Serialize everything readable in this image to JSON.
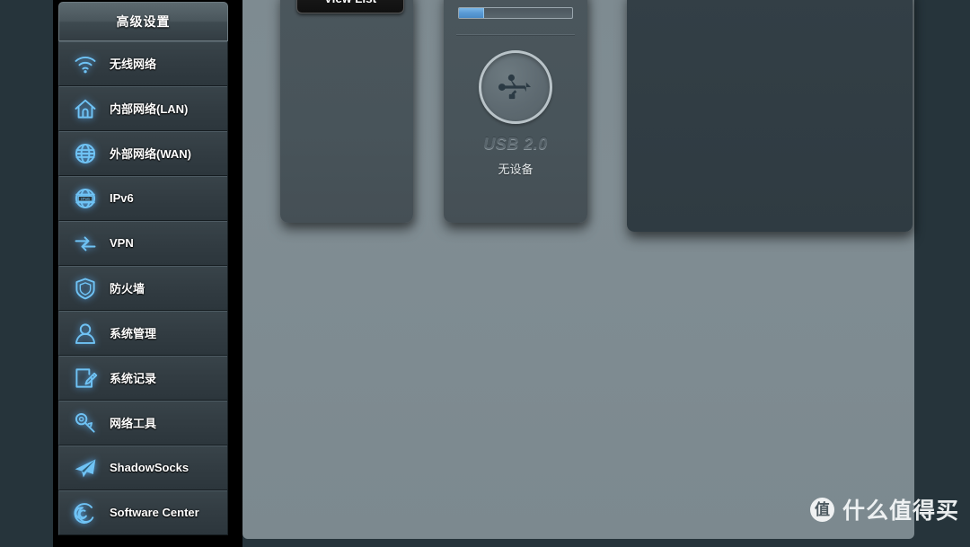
{
  "sidebar": {
    "header": "高级设置",
    "items": [
      {
        "label": "无线网络",
        "icon": "wifi-icon"
      },
      {
        "label": "内部网络(LAN)",
        "icon": "home-icon"
      },
      {
        "label": "外部网络(WAN)",
        "icon": "globe-icon"
      },
      {
        "label": "IPv6",
        "icon": "ipv6-globe-icon"
      },
      {
        "label": "VPN",
        "icon": "vpn-arrows-icon"
      },
      {
        "label": "防火墙",
        "icon": "shield-icon"
      },
      {
        "label": "系统管理",
        "icon": "user-icon"
      },
      {
        "label": "系统记录",
        "icon": "notepad-pencil-icon"
      },
      {
        "label": "网络工具",
        "icon": "wrench-icon"
      },
      {
        "label": "ShadowSocks",
        "icon": "paper-plane-icon"
      },
      {
        "label": "Software Center",
        "icon": "debian-spiral-icon"
      }
    ]
  },
  "main": {
    "clients_card": {
      "view_list_label": "View List"
    },
    "usb_card": {
      "progress_percent": "22",
      "usb_title": "USB 2.0",
      "usb_status": "无设备",
      "usb_icon": "usb-trident-icon"
    }
  },
  "watermark": {
    "logo_char": "值",
    "text": "什么值得买"
  },
  "colors": {
    "page_background": "#26343b",
    "sidebar_item": "#333d43",
    "main_panel": "#7e8b91",
    "card": "#48545a",
    "icon_blue": "#6fc3f5",
    "progress_blue": "#5a9ad4",
    "text_white": "#ffffff"
  }
}
